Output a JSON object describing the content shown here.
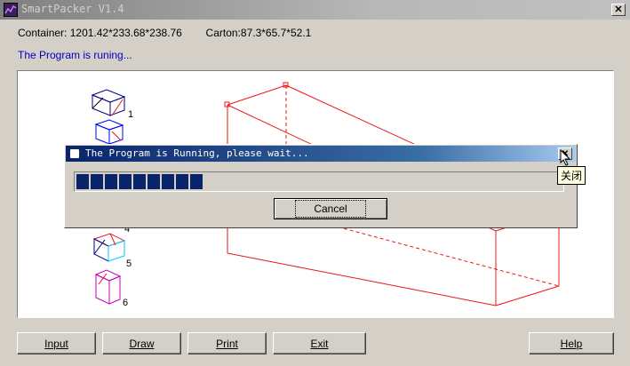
{
  "window": {
    "title": "SmartPacker V1.4",
    "close_glyph": "✕"
  },
  "info": {
    "container_label": "Container:",
    "container_value": "1201.42*233.68*238.76",
    "carton_label": "Carton:",
    "carton_value": "87.3*65.7*52.1"
  },
  "status_text": "The Program is runing...",
  "legend": [
    "1",
    "4",
    "5",
    "6"
  ],
  "buttons": {
    "input": "Input",
    "draw": "Draw",
    "print": "Print",
    "exit": "Exit",
    "help": "Help"
  },
  "dialog": {
    "title": "The Program is Running, please wait...",
    "close_glyph": "✕",
    "cancel_label": "Cancel",
    "progress_segments": 9
  },
  "tooltip_text": "关闭",
  "colors": {
    "container_line": "#e8181a",
    "progress_fill": "#0a246a",
    "status_text": "#0000c0",
    "carton_1": "#000080",
    "carton_2": "#0000ff",
    "carton_4": "#ff00ff",
    "carton_5": "#00c8ff",
    "carton_6": "#c000c0"
  }
}
